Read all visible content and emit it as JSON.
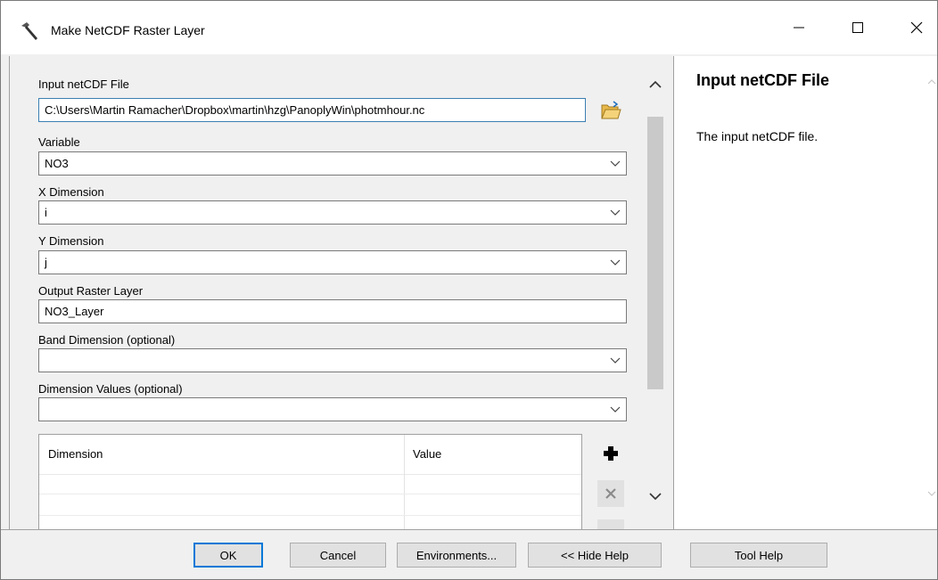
{
  "window": {
    "title": "Make NetCDF Raster Layer"
  },
  "form": {
    "input_file": {
      "label": "Input netCDF File",
      "value": "C:\\Users\\Martin Ramacher\\Dropbox\\martin\\hzg\\PanoplyWin\\photmhour.nc"
    },
    "variable": {
      "label": "Variable",
      "value": "NO3"
    },
    "x_dimension": {
      "label": "X Dimension",
      "value": "i"
    },
    "y_dimension": {
      "label": "Y Dimension",
      "value": "j"
    },
    "output_layer": {
      "label": "Output Raster Layer",
      "value": "NO3_Layer"
    },
    "band_dimension": {
      "label": "Band Dimension (optional)",
      "value": ""
    },
    "dimension_values": {
      "label": "Dimension Values (optional)",
      "value": ""
    },
    "table": {
      "columns": [
        "Dimension",
        "Value"
      ]
    }
  },
  "help": {
    "title": "Input netCDF File",
    "text": "The input netCDF file."
  },
  "buttons": {
    "ok": "OK",
    "cancel": "Cancel",
    "environments": "Environments...",
    "hide_help": "<< Hide Help",
    "tool_help": "Tool Help"
  },
  "colors": {
    "focus_border": "#0078d7",
    "add_icon": "#000000",
    "remove_icon": "#9a9a9a"
  }
}
